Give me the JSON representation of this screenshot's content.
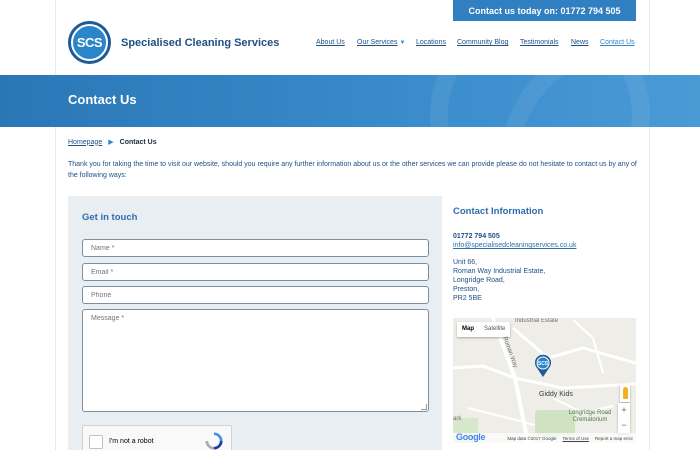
{
  "top_contact": "Contact us today on: 01772 794 505",
  "logo_text": "SCS",
  "brand_name": "Specialised Cleaning Services",
  "nav": [
    {
      "label": "About Us"
    },
    {
      "label": "Our Services"
    },
    {
      "label": "Locations"
    },
    {
      "label": "Community Blog"
    },
    {
      "label": "Testimonials"
    },
    {
      "label": "News"
    },
    {
      "label": "Contact Us"
    }
  ],
  "banner_title": "Contact Us",
  "breadcrumb": {
    "home": "Homepage",
    "current": "Contact Us"
  },
  "intro": "Thank you for taking the time to visit our website, should you require any further information about us or the other services we can provide please do not hesitate to contact us by any of the following ways:",
  "form": {
    "title": "Get in touch",
    "name_placeholder": "Name *",
    "email_placeholder": "Email *",
    "phone_placeholder": "Phone",
    "message_placeholder": "Message *",
    "captcha_label": "I'm not a robot"
  },
  "contact_info": {
    "title": "Contact Information",
    "phone": "01772 794 505",
    "email": "info@specialisedcleaningservices.co.uk",
    "address": [
      "Unit 66,",
      "Roman Way Industrial Estate,",
      "Longridge Road,",
      "Preston,",
      "PR2 5BE"
    ]
  },
  "map": {
    "type_map": "Map",
    "type_satellite": "Satellite",
    "label_industrial": "Industrial Estate",
    "label_roman_way": "Roman Way",
    "label_giddy": "Giddy Kids",
    "label_crematorium": "Longridge Road Crematorium",
    "label_park": "ark",
    "zoom_in": "+",
    "zoom_out": "−",
    "google": "Google",
    "map_data": "Map data ©2017 Google",
    "terms": "Terms of Use",
    "report": "Report a map error",
    "pin_text": "SCS"
  },
  "colors": {
    "primary": "#2f7fc1",
    "navy": "#1e4f86",
    "panel": "#e9eef2"
  }
}
